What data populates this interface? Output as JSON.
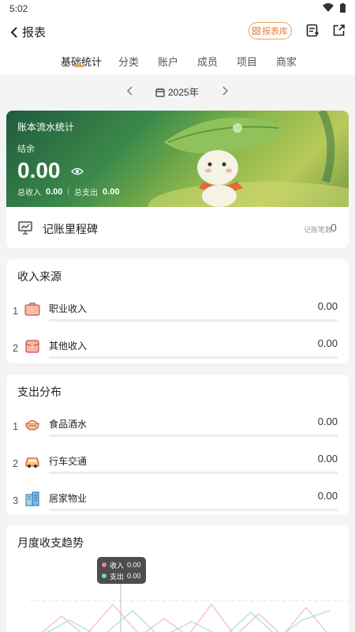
{
  "status": {
    "time": "5:02"
  },
  "header": {
    "back_label": "报表",
    "library_label": "报表库"
  },
  "tabs": [
    {
      "label": "基础统计",
      "active": true
    },
    {
      "label": "分类"
    },
    {
      "label": "账户"
    },
    {
      "label": "成员"
    },
    {
      "label": "项目"
    },
    {
      "label": "商家"
    }
  ],
  "year": {
    "label": "2025年"
  },
  "summary": {
    "title": "账本流水统计",
    "balance_label": "结余",
    "balance": "0.00",
    "income_label": "总收入",
    "income": "0.00",
    "expense_label": "总支出",
    "expense": "0.00"
  },
  "milestone": {
    "label": "记账里程碑",
    "count_label": "记账笔数",
    "count": "0"
  },
  "income_section": {
    "title": "收入来源",
    "items": [
      {
        "rank": "1",
        "label": "职业收入",
        "amount": "0.00",
        "icon": "briefcase-icon"
      },
      {
        "rank": "2",
        "label": "其他收入",
        "amount": "0.00",
        "icon": "red-envelope-icon"
      }
    ]
  },
  "expense_section": {
    "title": "支出分布",
    "items": [
      {
        "rank": "1",
        "label": "食品酒水",
        "amount": "0.00",
        "icon": "food-bowl-icon"
      },
      {
        "rank": "2",
        "label": "行车交通",
        "amount": "0.00",
        "icon": "car-icon"
      },
      {
        "rank": "3",
        "label": "居家物业",
        "amount": "0.00",
        "icon": "building-icon"
      }
    ]
  },
  "trend": {
    "title": "月度收支趋势",
    "tooltip": {
      "income_label": "收入",
      "income": "0.00",
      "expense_label": "支出",
      "expense": "0.00"
    },
    "colors": {
      "income": "#f08a8a",
      "expense": "#7ecfc4"
    }
  },
  "colors": {
    "accent": "#e8823a",
    "tab_indicator": "#f2a33a"
  }
}
